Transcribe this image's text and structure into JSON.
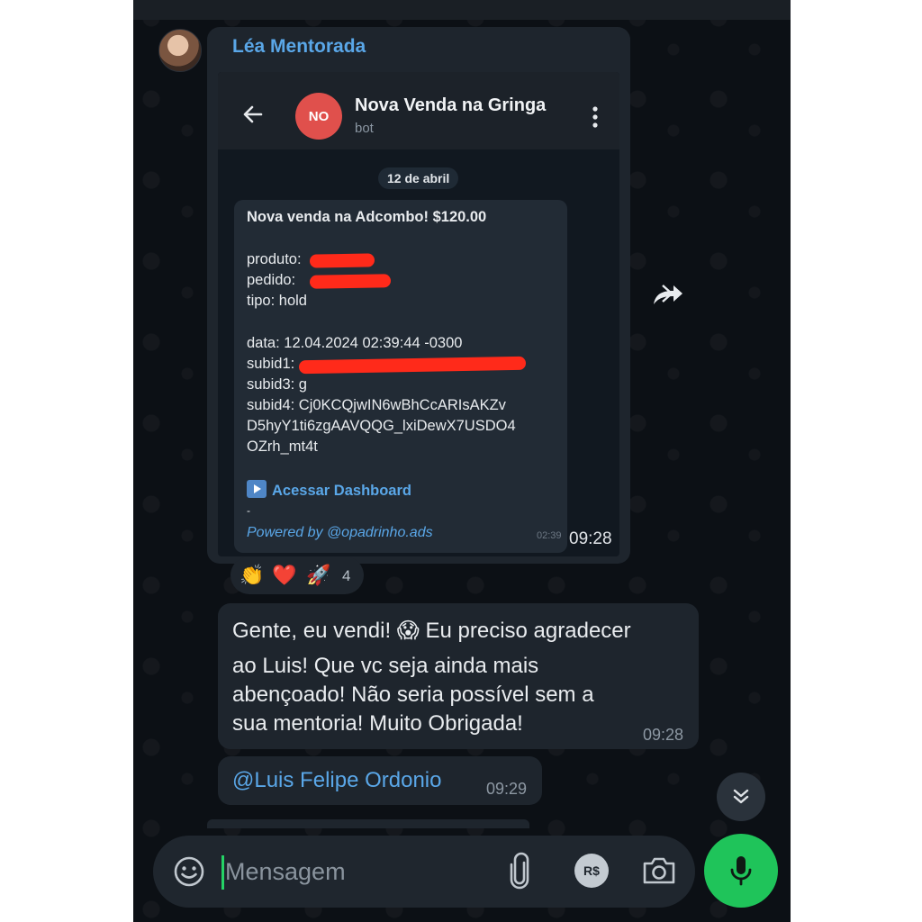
{
  "chat": {
    "sender_name": "Léa Mentorada",
    "forwarded_screenshot": {
      "bot_initials": "NO",
      "bot_name": "Nova Venda na Gringa",
      "bot_subtitle": "bot",
      "date_pill": "12 de abril",
      "message_lines": [
        "Nova venda na Adcombo! $120.00",
        "produto:",
        "pedido:",
        "tipo: hold",
        "data: 12.04.2024 02:39:44 -0300",
        "subid1:",
        "subid3: g",
        "subid4: Cj0KCQjwIN6wBhCcARIsAKZv",
        "D5hyY1ti6zgAAVQQG_lxiDewX7USDO4",
        "OZrh_mt4t"
      ],
      "dashboard_link": "Acessar Dashboard",
      "dash_line": "-",
      "powered_by": "Powered by @opadrinho.ads",
      "inner_time": "02:39"
    },
    "screenshot_time": "09:28",
    "reactions": {
      "emojis": [
        "👏",
        "❤️",
        "🚀"
      ],
      "count": "4"
    },
    "message2": {
      "line1_a": "Gente, eu vendi!",
      "emoji": "😱",
      "line1_b": "Eu preciso agradecer",
      "line2": "ao Luis! Que vc seja ainda mais",
      "line3": "abençoado! Não seria possível sem a",
      "line4": "sua mentoria! Muito Obrigada!",
      "time": "09:28"
    },
    "message3": {
      "mention": "@Luis Felipe Ordonio",
      "time": "09:29"
    }
  },
  "composer": {
    "placeholder": "Mensagem",
    "pay_label": "R$"
  },
  "icons": {
    "back": "arrow-left-icon",
    "menu": "vertical-dots-icon",
    "share": "forward-share-icon",
    "scroll": "double-chevron-down-icon",
    "emoji": "emoji-smile-icon",
    "attach": "paperclip-icon",
    "camera": "camera-icon",
    "mic": "microphone-icon"
  },
  "colors": {
    "background": "#0c1015",
    "bubble": "#1e252d",
    "link": "#5aa7e8",
    "accent_green": "#1fc45a",
    "bot_avatar": "#e0504c",
    "redaction": "#ff2a1a"
  }
}
